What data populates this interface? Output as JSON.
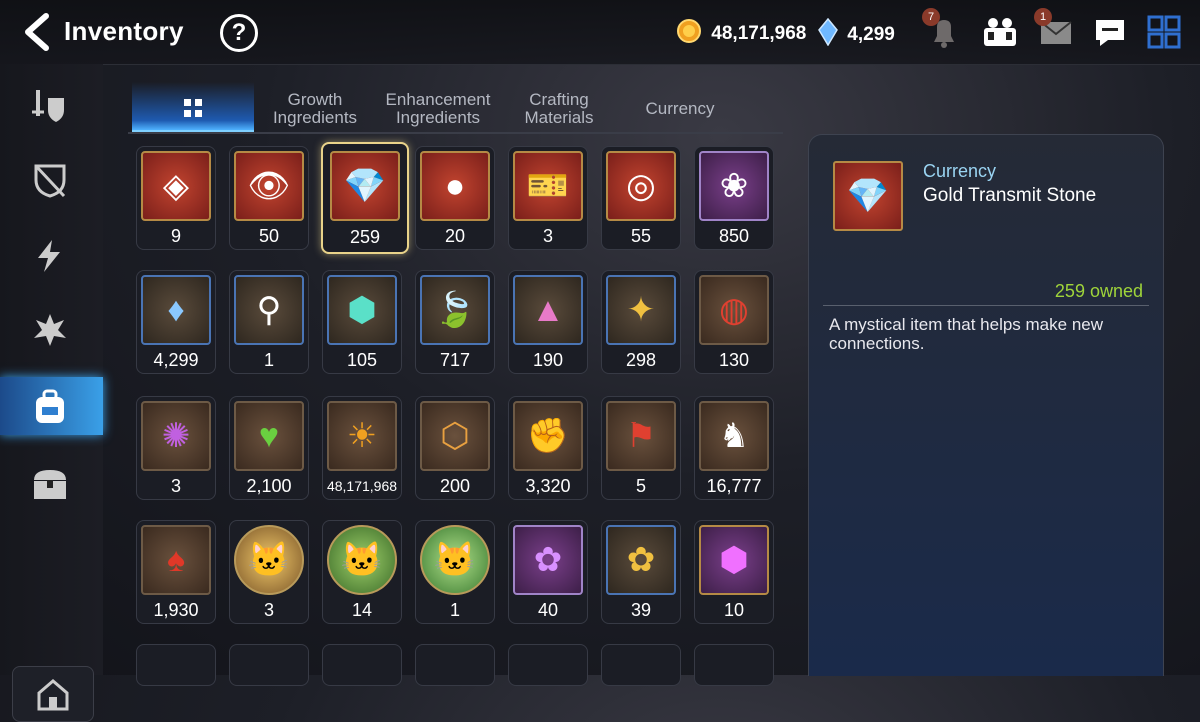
{
  "header": {
    "title": "Inventory",
    "help": "?"
  },
  "resources": {
    "gold": "48,171,968",
    "gems": "4,299"
  },
  "notifications": {
    "bell_count": "7",
    "mail_count": "1"
  },
  "tabs": [
    {
      "label": ""
    },
    {
      "label": "Growth\nIngredients"
    },
    {
      "label": "Enhancement\nIngredients"
    },
    {
      "label": "Crafting\nMaterials"
    },
    {
      "label": "Currency"
    }
  ],
  "items": [
    {
      "qty": "9"
    },
    {
      "qty": "50"
    },
    {
      "qty": "259"
    },
    {
      "qty": "20"
    },
    {
      "qty": "3"
    },
    {
      "qty": "55"
    },
    {
      "qty": "850"
    },
    {
      "qty": "4,299"
    },
    {
      "qty": "1"
    },
    {
      "qty": "105"
    },
    {
      "qty": "717"
    },
    {
      "qty": "190"
    },
    {
      "qty": "298"
    },
    {
      "qty": "130"
    },
    {
      "qty": "3"
    },
    {
      "qty": "2,100"
    },
    {
      "qty": "48,171,968"
    },
    {
      "qty": "200"
    },
    {
      "qty": "3,320"
    },
    {
      "qty": "5"
    },
    {
      "qty": "16,777"
    },
    {
      "qty": "1,930"
    },
    {
      "qty": "3"
    },
    {
      "qty": "14"
    },
    {
      "qty": "1"
    },
    {
      "qty": "40"
    },
    {
      "qty": "39"
    },
    {
      "qty": "10"
    }
  ],
  "detail": {
    "category": "Currency",
    "name": "Gold Transmit Stone",
    "owned": "259 owned",
    "description": "A mystical item that helps make new connections."
  },
  "colors": {
    "accent": "#3aa0e8",
    "owned": "#9fd43a",
    "category": "#9ad4f2"
  }
}
